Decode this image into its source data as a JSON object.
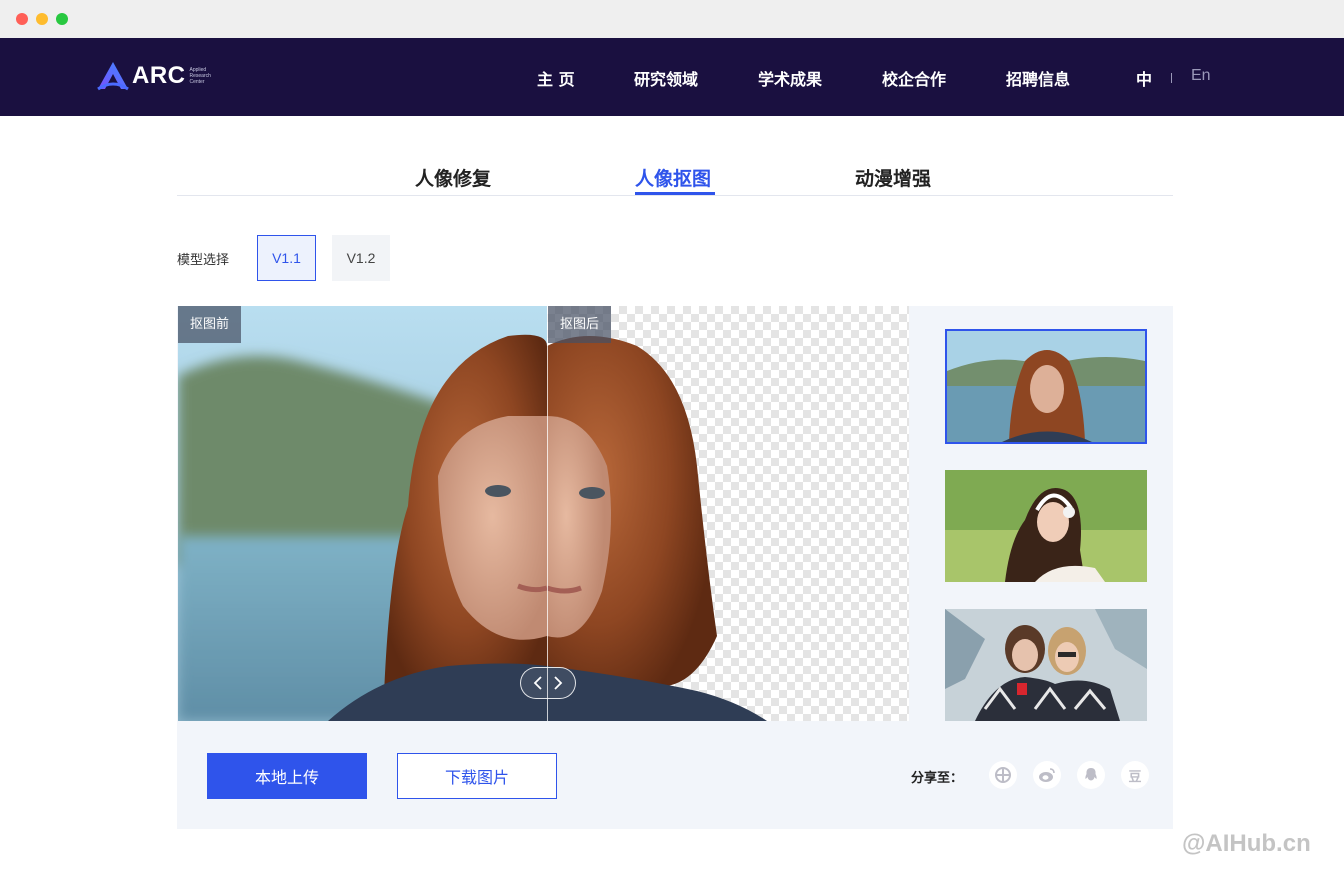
{
  "nav": {
    "logo_text": "ARC",
    "logo_subtitle": [
      "Applied",
      "Research",
      "Center"
    ],
    "menu": [
      "主 页",
      "研究领域",
      "学术成果",
      "校企合作",
      "招聘信息"
    ],
    "lang_cn": "中",
    "lang_en": "En"
  },
  "tabs": {
    "items": [
      "人像修复",
      "人像抠图",
      "动漫增强"
    ],
    "active": "人像抠图"
  },
  "model": {
    "label": "模型选择",
    "versions": [
      "V1.1",
      "V1.2"
    ],
    "selected": "V1.1"
  },
  "compare": {
    "before_label": "抠图前",
    "after_label": "抠图后"
  },
  "actions": {
    "upload_label": "本地上传",
    "download_label": "下载图片"
  },
  "share": {
    "label": "分享至：",
    "targets": [
      "wechat-moments",
      "weibo",
      "qq",
      "douban"
    ],
    "douban_glyph": "豆"
  },
  "colors": {
    "nav_bg": "#1a1040",
    "accent": "#2f54eb",
    "panel_bg": "#f2f5fa"
  },
  "watermark": "@AIHub.cn"
}
